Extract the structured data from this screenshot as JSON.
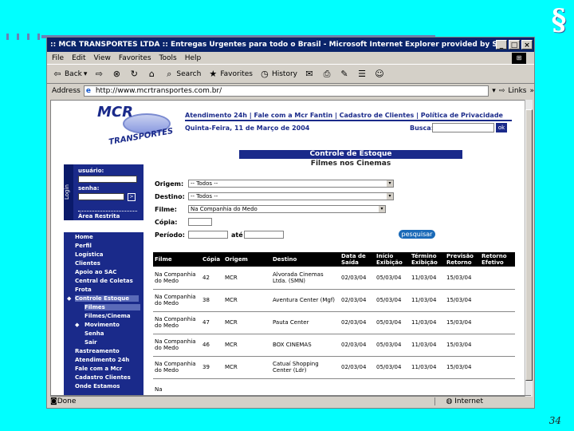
{
  "slide": {
    "page_number": "34",
    "accent": "#00ffff",
    "logo_glyph": "§"
  },
  "window": {
    "title": ":: MCR TRANSPORTES LTDA :: Entregas Urgentes para todo o Brasil - Microsoft Internet Explorer provided by So...",
    "menu": [
      "File",
      "Edit",
      "View",
      "Favorites",
      "Tools",
      "Help"
    ],
    "toolbar": {
      "back": "Back",
      "search": "Search",
      "favorites": "Favorites",
      "history": "History"
    },
    "address_label": "Address",
    "address_value": "http://www.mcrtransportes.com.br/",
    "links_label": "Links",
    "status_left": "Done",
    "status_zone": "Internet"
  },
  "site": {
    "logo_text": "MCR",
    "logo_sub": "TRANSPORTES",
    "top_links": "Atendimento 24h | Fale com a Mcr Fantin | Cadastro de Clientes | Política de Privacidade",
    "date": "Quinta-Feira, 11 de Março de 2004",
    "busca_label": "Busca:",
    "busca_btn": "ok",
    "page_title": "Controle de Estoque",
    "page_subtitle": "Filmes nos Cinemas",
    "login": {
      "tab": "Login",
      "user_label": "usuário:",
      "pass_label": "senha:",
      "go": ">",
      "restricted": "Área Restrita"
    },
    "nav": [
      "Home",
      "Perfil",
      "Logística",
      "Clientes",
      "Apoio ao SAC",
      "Central de Coletas",
      "Frota",
      "Controle Estoque",
      "Filmes",
      "Filmes/Cinema",
      "Movimento",
      "Senha",
      "Sair",
      "Rastreamento",
      "Atendimento 24h",
      "Fale com a Mcr",
      "Cadastro Clientes",
      "Onde Estamos"
    ],
    "filters": {
      "origem_label": "Origem:",
      "origem_value": "-- Todos --",
      "destino_label": "Destino:",
      "destino_value": "-- Todos --",
      "filme_label": "Filme:",
      "filme_value": "Na Companhia do Medo",
      "copia_label": "Cópia:",
      "periodo_label": "Período:",
      "periodo_ate": "até",
      "pesquisar": "pesquisar"
    },
    "table": {
      "headers": [
        "Filme",
        "Cópia",
        "Origem",
        "Destino",
        "Data de Saída",
        "Início Exibição",
        "Término Exibição",
        "Previsão Retorno",
        "Retorno Efetivo"
      ],
      "rows": [
        [
          "Na Companhia do Medo",
          "42",
          "MCR",
          "Alvorada Cinemas Ltda. (SMN)",
          "02/03/04",
          "05/03/04",
          "11/03/04",
          "15/03/04",
          ""
        ],
        [
          "Na Companhia do Medo",
          "38",
          "MCR",
          "Aventura Center (Mgf)",
          "02/03/04",
          "05/03/04",
          "11/03/04",
          "15/03/04",
          ""
        ],
        [
          "Na Companhia do Medo",
          "47",
          "MCR",
          "Pauta Center",
          "02/03/04",
          "05/03/04",
          "11/03/04",
          "15/03/04",
          ""
        ],
        [
          "Na Companhia do Medo",
          "46",
          "MCR",
          "BOX CINEMAS",
          "02/03/04",
          "05/03/04",
          "11/03/04",
          "15/03/04",
          ""
        ],
        [
          "Na Companhia do Medo",
          "39",
          "MCR",
          "Catuaí Shopping Center (Ldr)",
          "02/03/04",
          "05/03/04",
          "11/03/04",
          "15/03/04",
          ""
        ],
        [
          "Na",
          "",
          "",
          "",
          "",
          "",
          "",
          "",
          ""
        ]
      ]
    }
  }
}
